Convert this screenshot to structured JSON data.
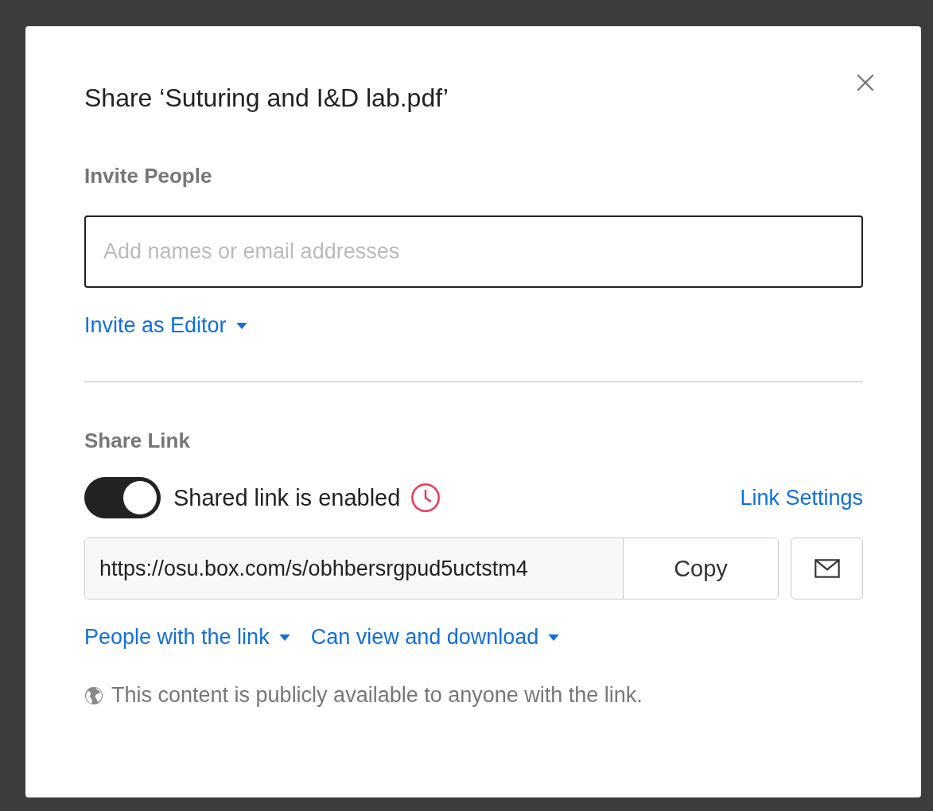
{
  "dialog": {
    "title": "Share ‘Suturing and I&D lab.pdf’"
  },
  "invite": {
    "heading": "Invite People",
    "placeholder": "Add names or email addresses",
    "role_menu": "Invite as Editor"
  },
  "share_link": {
    "heading": "Share Link",
    "toggle": {
      "on": true,
      "label": "Shared link is enabled"
    },
    "expiry_set": true,
    "settings_link": "Link Settings",
    "url": "https://osu.box.com/s/obhbersrgpud5uctstm4",
    "copy_button": "Copy",
    "access_menu": "People with the link",
    "permission_menu": "Can view and download",
    "notice": "This content is publicly available to anyone with the link."
  }
}
